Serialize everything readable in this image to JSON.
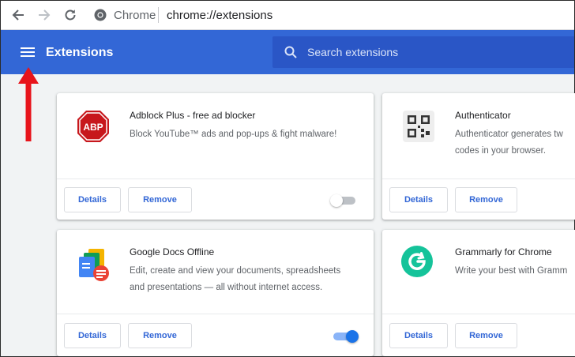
{
  "browser": {
    "omnibox_label": "Chrome",
    "url": "chrome://extensions"
  },
  "header": {
    "title": "Extensions",
    "search_placeholder": "Search extensions"
  },
  "extensions": [
    {
      "name": "Adblock Plus - free ad blocker",
      "description": "Block YouTube™ ads and pop-ups & fight malware!",
      "icon": "abp-icon",
      "icon_text": "ABP",
      "details_label": "Details",
      "remove_label": "Remove",
      "enabled": false
    },
    {
      "name": "Authenticator",
      "description": "Authenticator generates tw codes in your browser.",
      "icon": "qr-code-icon",
      "details_label": "Details",
      "remove_label": "Remove"
    },
    {
      "name": "Google Docs Offline",
      "description": "Edit, create and view your documents, spreadsheets and presentations — all without internet access.",
      "icon": "docs-offline-icon",
      "details_label": "Details",
      "remove_label": "Remove",
      "enabled": true
    },
    {
      "name": "Grammarly for Chrome",
      "description": "Write your best with Gramm",
      "icon": "grammarly-icon",
      "details_label": "Details",
      "remove_label": "Remove"
    }
  ],
  "colors": {
    "header_blue": "#3367d6",
    "annotation_red": "#e8141b",
    "abp_red": "#c7171c",
    "grammarly_green": "#15c39a"
  }
}
